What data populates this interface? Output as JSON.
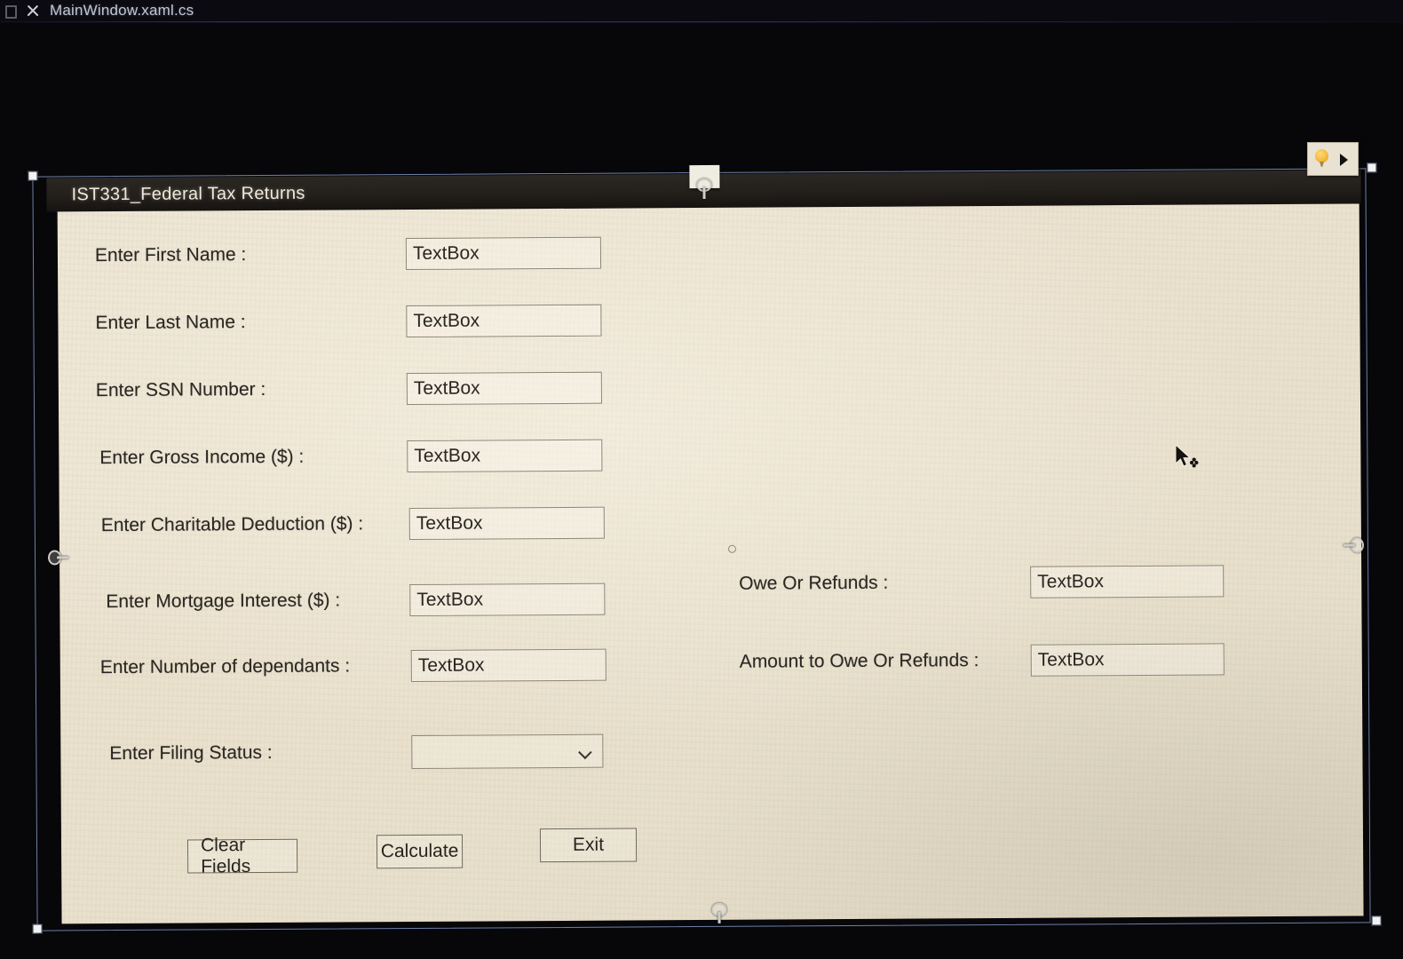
{
  "editor": {
    "tab_label": "MainWindow.xaml.cs",
    "tab_icon": "file-icon",
    "close_icon": "close-icon"
  },
  "quick_actions": {
    "bulb_icon": "lightbulb-icon",
    "expander_icon": "triangle-right-icon"
  },
  "window": {
    "title": "IST331_Federal Tax Returns"
  },
  "cursor": {
    "icon": "move-cursor"
  },
  "form": {
    "left_fields": [
      {
        "label": "Enter First Name :",
        "value": "TextBox"
      },
      {
        "label": "Enter Last Name :",
        "value": "TextBox"
      },
      {
        "label": "Enter SSN Number :",
        "value": "TextBox"
      },
      {
        "label": "Enter Gross Income ($) :",
        "value": "TextBox"
      },
      {
        "label": "Enter Charitable Deduction ($) :",
        "value": "TextBox"
      },
      {
        "label": "Enter Mortgage Interest ($) :",
        "value": "TextBox"
      },
      {
        "label": "Enter Number of dependants :",
        "value": "TextBox"
      }
    ],
    "filing_status": {
      "label": "Enter Filing Status :",
      "value": "",
      "chevron_icon": "chevron-down-icon"
    },
    "right_fields": [
      {
        "label": "Owe Or Refunds :",
        "value": "TextBox"
      },
      {
        "label": "Amount to Owe Or Refunds :",
        "value": "TextBox"
      }
    ],
    "buttons": [
      {
        "label": "Clear Fields"
      },
      {
        "label": "Calculate"
      },
      {
        "label": "Exit"
      }
    ]
  },
  "colors": {
    "form_background": "#ECE1CD",
    "titlebar": "#231F1B",
    "desktop": "#07070A",
    "accent_underline": "#4B3FA8",
    "bulb": "#F3B93B"
  }
}
